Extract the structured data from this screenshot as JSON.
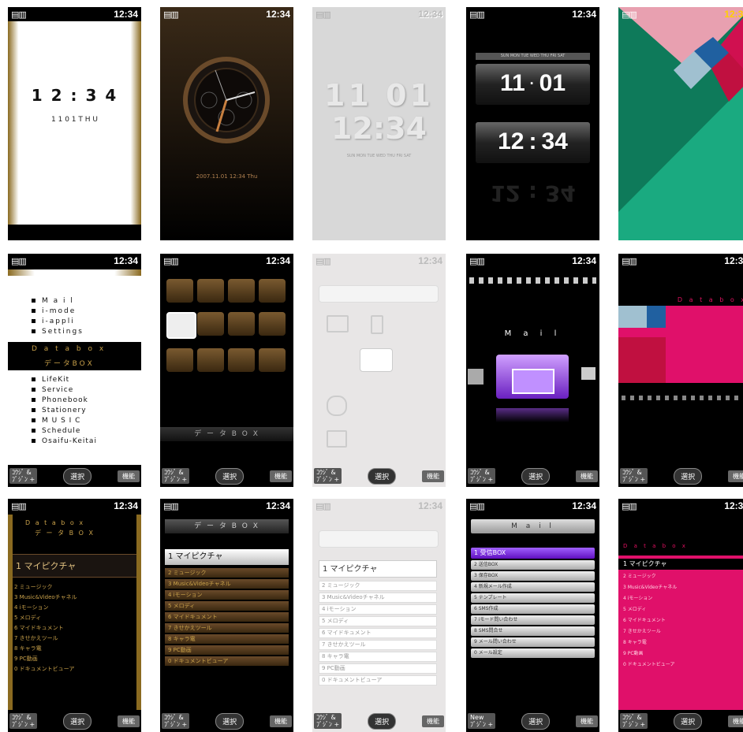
{
  "status_time": "12:34",
  "softkeys": {
    "left_top": "ｺｳｼﾞ &",
    "left_bottom": "ﾌﾞｼﾞﾝ +",
    "center": "選択",
    "right": "機能",
    "right_new": "New"
  },
  "row1": {
    "s1": {
      "time": "1 2 : 3 4",
      "date": "1 1  0 1  T H U"
    },
    "s2": {
      "datetime": "2007.11.01 12:34 Thu"
    },
    "s3": {
      "date": "11 01",
      "time": "12:34",
      "days": "SUN MON TUE WED THU FRI SAT"
    },
    "s4": {
      "days": "SUN MON TUE WED THU FRI SAT",
      "month": "11",
      "day": "01",
      "hour": "12",
      "minute": "34",
      "sep": "·",
      "colon": ":",
      "refl": "12 : 34"
    }
  },
  "row2": {
    "s1": {
      "items": [
        "M a i l",
        "i-mode",
        "i-appli",
        "Settings"
      ],
      "selected_en": "D a t a b o x",
      "selected_jp": "デ ー タ B O X",
      "items2": [
        "LifeKit",
        "Service",
        "Phonebook",
        "Stationery",
        "M U S I C",
        "Schedule",
        "Osaifu-Keitai"
      ]
    },
    "s2": {
      "label": "デ ー タ B O X"
    },
    "s4": {
      "label": "M a i l"
    },
    "s5": {
      "label": "D a t a b o x"
    }
  },
  "row3": {
    "s1": {
      "header_en": "D a t a b o x",
      "header_jp": "デ ー タ B O X",
      "items": [
        "1 マイピクチャ",
        "2 ミュージック",
        "3 Music&Videoチャネル",
        "4 iモーション",
        "5 メロディ",
        "6 マイドキュメント",
        "7 きせかえツール",
        "8 キャラ電",
        "9 PC動画",
        "0 ドキュメントビューア"
      ]
    },
    "s2": {
      "header": "デ ー タ B O X",
      "items": [
        "1 マイピクチャ",
        "2 ミュージック",
        "3 Music&Videoチャネル",
        "4 iモーション",
        "5 メロディ",
        "6 マイドキュメント",
        "7 きせかえツール",
        "8 キャラ電",
        "9 PC動画",
        "0 ドキュメントビューア"
      ]
    },
    "s3": {
      "items": [
        "1 マイピクチャ",
        "2 ミュージック",
        "3 Music&Videoチャネル",
        "4 iモーション",
        "5 メロディ",
        "6 マイドキュメント",
        "7 きせかえツール",
        "8 キャラ電",
        "9 PC動画",
        "0 ドキュメントビューア"
      ]
    },
    "s4": {
      "header": "M a i l",
      "items": [
        "1 受信BOX",
        "2 送信BOX",
        "3 保存BOX",
        "4 新規メール作成",
        "5 テンプレート",
        "6 SMS作成",
        "7 iモード問い合わせ",
        "8 SMS問合せ",
        "9 メール問い合わせ",
        "0 メール設定"
      ]
    },
    "s5": {
      "header": "D a t a b o x",
      "items": [
        "1 マイピクチャ",
        "2 ミュージック",
        "3 Music&Videoチャネル",
        "4 iモーション",
        "5 メロディ",
        "6 マイドキュメント",
        "7 きせかえツール",
        "8 キャラ電",
        "9 PC動画",
        "0 ドキュメントビューア"
      ]
    }
  }
}
